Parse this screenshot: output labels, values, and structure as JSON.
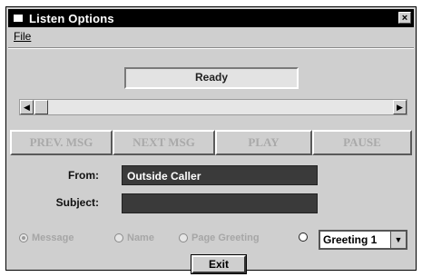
{
  "window": {
    "title": "Listen Options",
    "close_glyph": "×"
  },
  "menu": {
    "file_label": "File"
  },
  "status": {
    "text": "Ready"
  },
  "scrollbar": {
    "left_arrow": "◀",
    "right_arrow": "▶"
  },
  "buttons": {
    "prev": "PREV. MSG",
    "next": "NEXT MSG",
    "play": "PLAY",
    "pause": "PAUSE"
  },
  "form": {
    "from_label": "From:",
    "from_value": "Outside Caller",
    "subject_label": "Subject:",
    "subject_value": ""
  },
  "options": {
    "message": "Message",
    "name": "Name",
    "page_greeting": "Page Greeting",
    "greeting_select": "Greeting 1",
    "greeting_dropdown": "▼"
  },
  "exit_label": "Exit",
  "colors": {
    "titlebar": "#000000",
    "window_bg": "#cfcfcf",
    "field_bg": "#3a3a3a"
  }
}
